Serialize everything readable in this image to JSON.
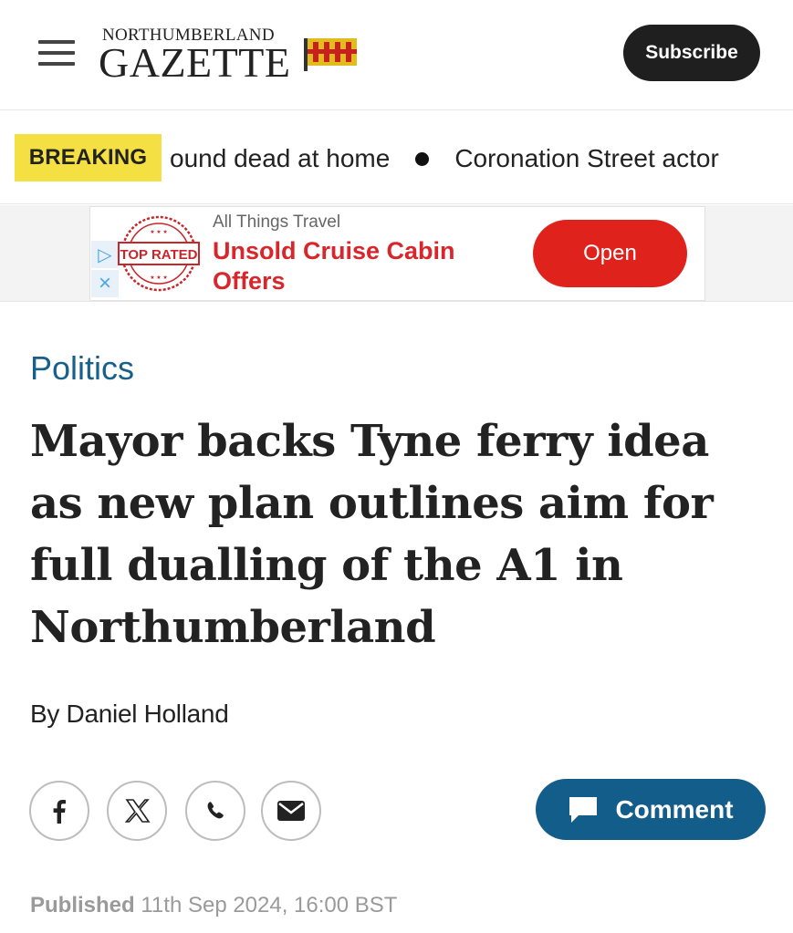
{
  "header": {
    "logo_top": "NORTHUMBERLAND",
    "logo_main": "GAZETTE",
    "subscribe_label": "Subscribe"
  },
  "ticker": {
    "breaking_label": "BREAKING",
    "items": [
      "ound dead at home",
      "Coronation Street actor"
    ]
  },
  "ad": {
    "stamp_text": "TOP RATED",
    "source": "All Things Travel",
    "title": "Unsold Cruise Cabin Offers",
    "open_label": "Open",
    "brand_color": "#e0221d"
  },
  "article": {
    "category": "Politics",
    "headline": "Mayor backs Tyne ferry idea as new plan outlines aim for full dualling of the A1 in Northumberland",
    "byline": "By Daniel Holland",
    "published_label": "Published",
    "published_date": "11th Sep 2024, 16:00 BST"
  },
  "share": {
    "icons": [
      "facebook-icon",
      "x-icon",
      "whatsapp-icon",
      "email-icon"
    ],
    "comment_label": "Comment",
    "comment_color": "#135d8b"
  }
}
